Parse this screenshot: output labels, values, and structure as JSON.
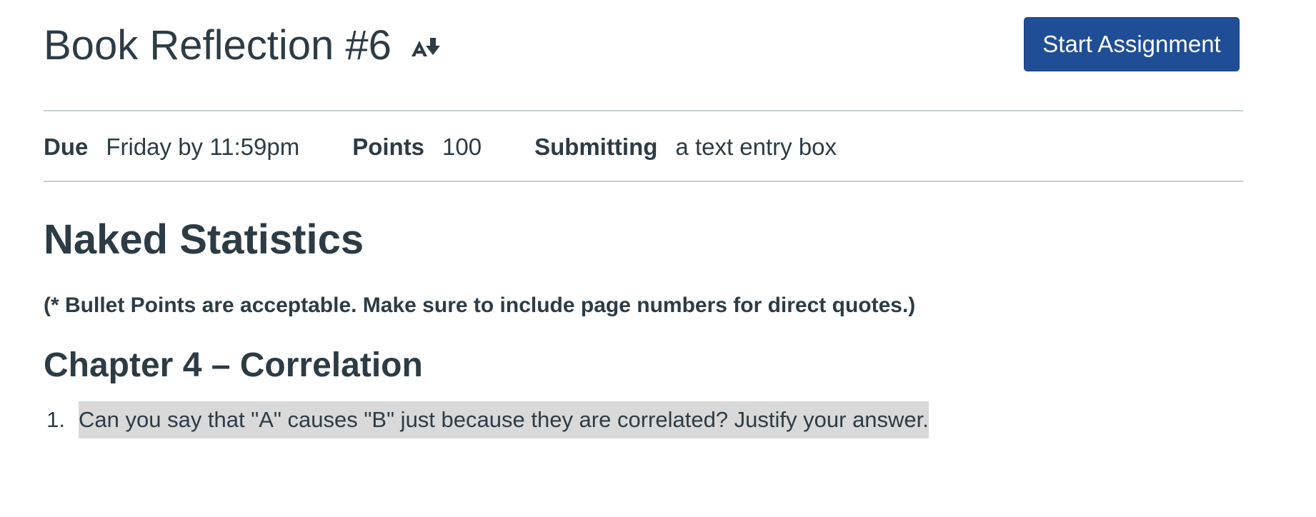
{
  "assignment": {
    "title": "Book Reflection #6",
    "immersive_reader_icon": "immersive-reader-icon",
    "start_button_label": "Start Assignment"
  },
  "details": {
    "due_label": "Due",
    "due_value": "Friday by 11:59pm",
    "points_label": "Points",
    "points_value": "100",
    "submitting_label": "Submitting",
    "submitting_value": "a text entry box"
  },
  "content": {
    "book_heading": "Naked Statistics",
    "note": "(* Bullet Points are acceptable. Make sure to include page numbers for direct quotes.)",
    "chapter_heading": "Chapter 4 – Correlation",
    "questions": [
      {
        "number": "1.",
        "text": "Can you say that \"A\" causes \"B\" just because they are correlated? Justify your answer."
      }
    ]
  },
  "colors": {
    "text": "#2d3b45",
    "button_bg": "#1f4e96",
    "divider": "#c7cdd1",
    "highlight": "#d9d9d9"
  }
}
